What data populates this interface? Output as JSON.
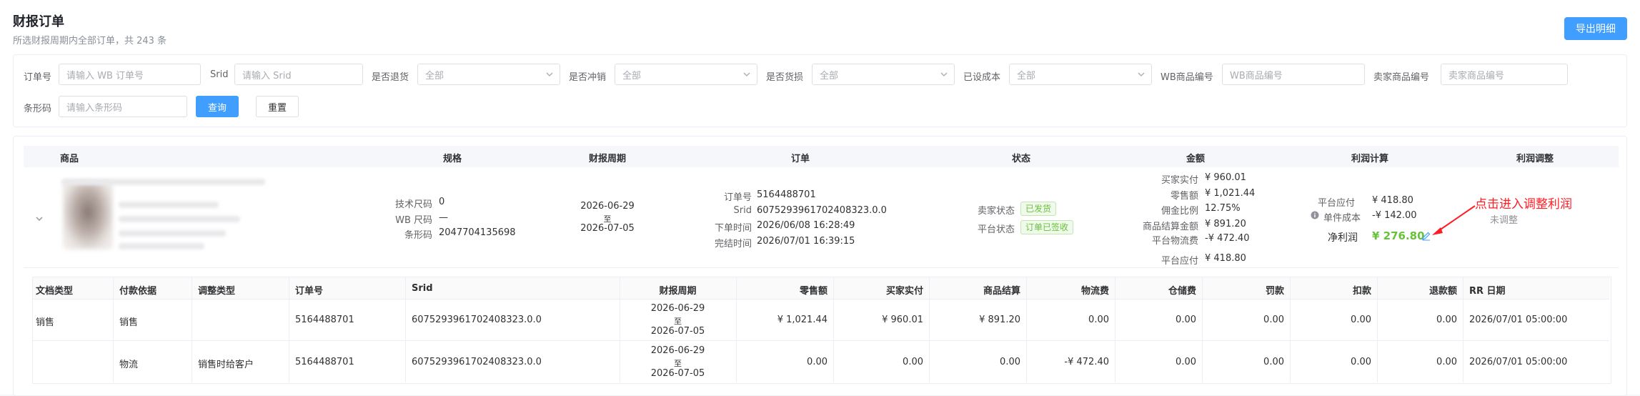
{
  "header": {
    "title": "财报订单",
    "subtitle": "所选财报周期内全部订单，共 243 条",
    "export_label": "导出明细"
  },
  "filters": {
    "order_no": {
      "label": "订单号",
      "placeholder": "请输入 WB 订单号"
    },
    "srid": {
      "label": "Srid",
      "placeholder": "请输入 Srid"
    },
    "is_return": {
      "label": "是否退货",
      "value": "全部"
    },
    "is_reversal": {
      "label": "是否冲销",
      "value": "全部"
    },
    "is_damaged": {
      "label": "是否货损",
      "value": "全部"
    },
    "cost_set": {
      "label": "已设成本",
      "value": "全部"
    },
    "wb_sku": {
      "label": "WB商品编号",
      "placeholder": "WB商品编号"
    },
    "seller_sku": {
      "label": "卖家商品编号",
      "placeholder": "卖家商品编号"
    },
    "barcode": {
      "label": "条形码",
      "placeholder": "请输入条形码"
    },
    "query_label": "查询",
    "reset_label": "重置"
  },
  "columns": {
    "product": "商品",
    "spec": "规格",
    "period": "财报周期",
    "order": "订单",
    "status": "状态",
    "amount": "金额",
    "profit": "利润计算",
    "adjust": "利润调整"
  },
  "order": {
    "spec": {
      "tech_size_label": "技术尺码",
      "tech_size": "0",
      "wb_size_label": "WB 尺码",
      "wb_size": "—",
      "barcode_label": "条形码",
      "barcode": "2047704135698"
    },
    "period": {
      "start": "2026-06-29",
      "to": "至",
      "end": "2026-07-05"
    },
    "info": {
      "order_no_label": "订单号",
      "order_no": "5164488701",
      "srid_label": "Srid",
      "srid": "6075293961702408323.0.0",
      "order_time_label": "下单时间",
      "order_time": "2026/06/08 16:28:49",
      "complete_time_label": "完结时间",
      "complete_time": "2026/07/01 16:39:15"
    },
    "status": {
      "seller_label": "卖家状态",
      "seller": "已发货",
      "platform_label": "平台状态",
      "platform": "订单已签收"
    },
    "amount": {
      "buyer_paid_label": "买家实付",
      "buyer_paid": "¥ 960.01",
      "retail_label": "零售额",
      "retail": "¥ 1,021.44",
      "commission_label": "佣金比例",
      "commission": "12.75%",
      "settlement_label": "商品结算金额",
      "settlement": "¥ 891.20",
      "logistics_label": "平台物流费",
      "logistics": "-¥ 472.40",
      "payable_label": "平台应付",
      "payable": "¥ 418.80"
    },
    "profit": {
      "payable_label": "平台应付",
      "payable": "¥ 418.80",
      "unit_cost_label": "单件成本",
      "unit_cost": "-¥ 142.00",
      "net_label": "净利润",
      "net": "¥ 276.80"
    },
    "adjust_status": "未调整"
  },
  "annotation": "点击进入调整利润",
  "detail_table": {
    "headers": [
      "文档类型",
      "付款依据",
      "调整类型",
      "订单号",
      "Srid",
      "财报周期",
      "零售额",
      "买家实付",
      "商品结算",
      "物流费",
      "仓储费",
      "罚款",
      "扣款",
      "退款额",
      "RR 日期"
    ],
    "rows": [
      {
        "doc": "销售",
        "basis": "销售",
        "adj": "",
        "order": "5164488701",
        "srid": "6075293961702408323.0.0",
        "p1": "2026-06-29",
        "p2": "至",
        "p3": "2026-07-05",
        "retail": "¥ 1,021.44",
        "paid": "¥ 960.01",
        "settle": "¥ 891.20",
        "logi": "0.00",
        "storage": "0.00",
        "fine": "0.00",
        "deduct": "0.00",
        "refund": "0.00",
        "rr": "2026/07/01 05:00:00"
      },
      {
        "doc": "",
        "basis": "物流",
        "adj": "销售时给客户",
        "order": "5164488701",
        "srid": "6075293961702408323.0.0",
        "p1": "2026-06-29",
        "p2": "至",
        "p3": "2026-07-05",
        "retail": "0.00",
        "paid": "0.00",
        "settle": "0.00",
        "logi": "-¥ 472.40",
        "storage": "0.00",
        "fine": "0.00",
        "deduct": "0.00",
        "refund": "0.00",
        "rr": "2026/07/01 05:00:00"
      }
    ]
  },
  "colors": {
    "primary": "#409eff",
    "success": "#67c23a",
    "annotation": "#ff1d25"
  }
}
